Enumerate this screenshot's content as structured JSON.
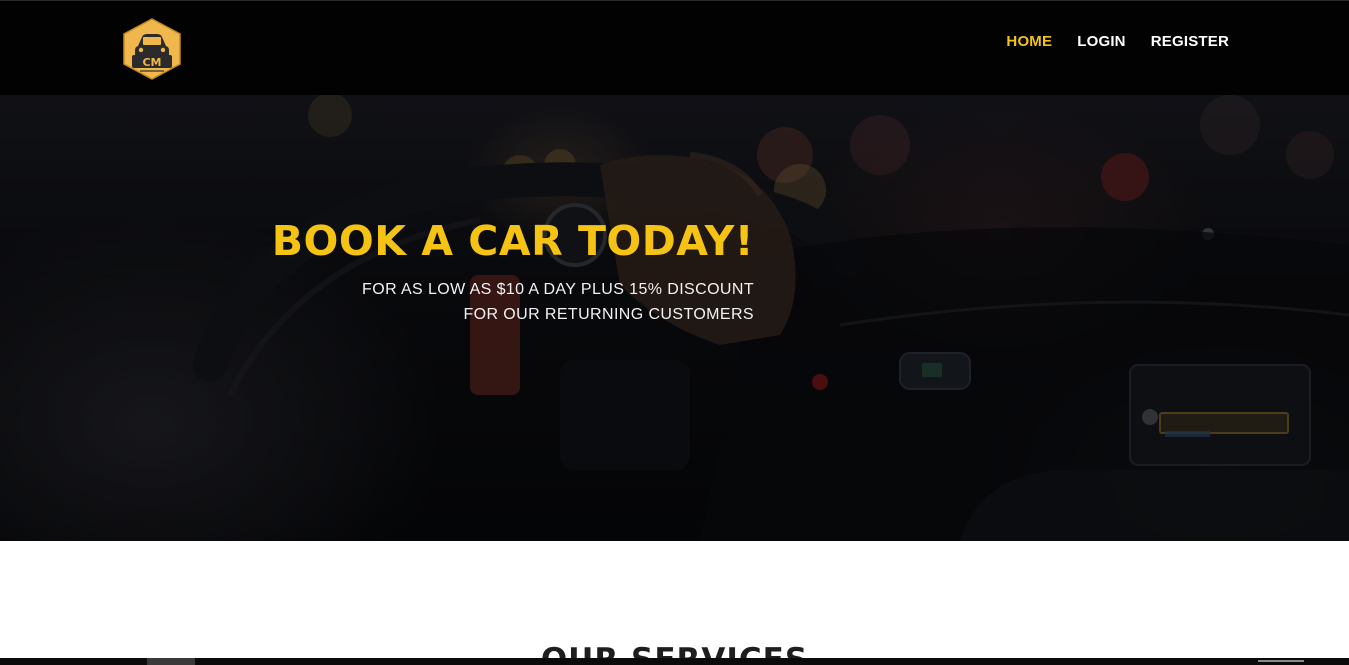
{
  "brand": {
    "logo_name": "car-logo",
    "logo_text": "CM",
    "accent_color": "#f2c318"
  },
  "nav": {
    "items": [
      {
        "label": "HOME",
        "active": true
      },
      {
        "label": "LOGIN",
        "active": false
      },
      {
        "label": "REGISTER",
        "active": false
      }
    ]
  },
  "hero": {
    "title": "BOOK A CAR TODAY!",
    "subtitle_line1": "FOR AS LOW AS $10 A DAY PLUS 15% DISCOUNT",
    "subtitle_line2": "FOR OUR RETURNING CUSTOMERS",
    "title_color": "#f5c313"
  },
  "services": {
    "title": "OUR SERVICES"
  }
}
